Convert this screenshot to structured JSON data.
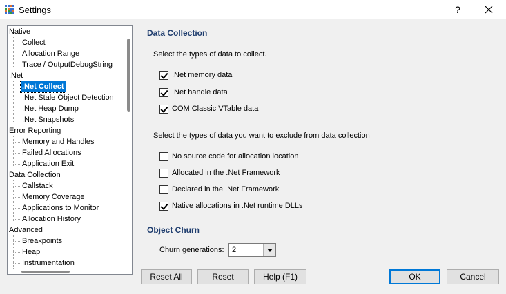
{
  "window": {
    "title": "Settings",
    "help_glyph": "?",
    "close_glyph": "✕"
  },
  "tree": {
    "items": [
      {
        "label": "Native"
      },
      {
        "label": "Collect"
      },
      {
        "label": "Allocation Range"
      },
      {
        "label": "Trace / OutputDebugString"
      },
      {
        "label": ".Net"
      },
      {
        "label": ".Net Collect"
      },
      {
        "label": ".Net Stale Object Detection"
      },
      {
        "label": ".Net Heap Dump"
      },
      {
        "label": ".Net Snapshots"
      },
      {
        "label": "Error Reporting"
      },
      {
        "label": "Memory and Handles"
      },
      {
        "label": "Failed Allocations"
      },
      {
        "label": "Application Exit"
      },
      {
        "label": "Data Collection"
      },
      {
        "label": "Callstack"
      },
      {
        "label": "Memory Coverage"
      },
      {
        "label": "Applications to Monitor"
      },
      {
        "label": "Allocation History"
      },
      {
        "label": "Advanced"
      },
      {
        "label": "Breakpoints"
      },
      {
        "label": "Heap"
      },
      {
        "label": "Instrumentation"
      }
    ],
    "selected": ".Net Collect"
  },
  "data_collection": {
    "header": "Data Collection",
    "collect_prompt": "Select the types of data to collect.",
    "collect_options": [
      {
        "label": ".Net memory data",
        "checked": true
      },
      {
        "label": ".Net handle data",
        "checked": true
      },
      {
        "label": "COM Classic VTable data",
        "checked": true
      }
    ],
    "exclude_prompt": "Select the types of data you want to exclude from data collection",
    "exclude_options": [
      {
        "label": "No source code for allocation location",
        "checked": false
      },
      {
        "label": "Allocated in the .Net Framework",
        "checked": false
      },
      {
        "label": "Declared in the .Net Framework",
        "checked": false
      },
      {
        "label": "Native allocations in .Net runtime DLLs",
        "checked": true
      }
    ]
  },
  "object_churn": {
    "header": "Object Churn",
    "generations_label": "Churn generations:",
    "generations_value": "2"
  },
  "buttons": {
    "reset_all": "Reset All",
    "reset": "Reset",
    "help": "Help (F1)",
    "ok": "OK",
    "cancel": "Cancel"
  }
}
